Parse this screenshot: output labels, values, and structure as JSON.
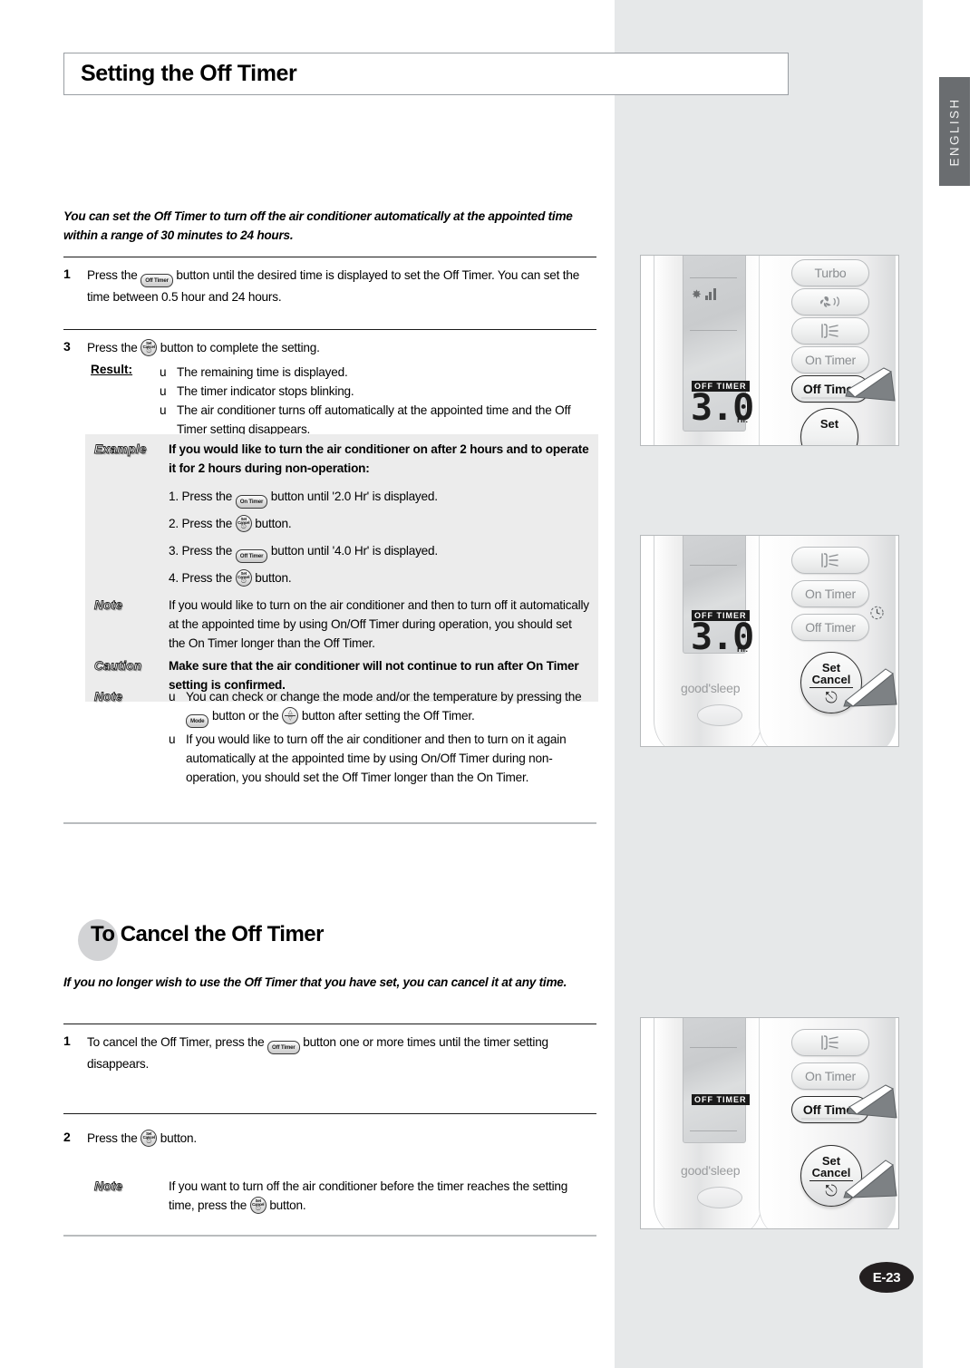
{
  "page": {
    "language_tab": "ENGLISH",
    "page_number": "E-23"
  },
  "title": "Setting the Off Timer",
  "section1": {
    "lead": "You can set the Off Timer to turn off the air conditioner automatically at the appointed time within a range of 30 minutes to 24 hours.",
    "step1": {
      "number": "1",
      "text_before": "Press the",
      "button": "Off Timer",
      "text_after": "button until the desired time is displayed to set the Off Timer. You can set the time between 0.5 hour and 24 hours."
    },
    "step3": {
      "number": "3",
      "text_before": "Press the",
      "button_line1": "Set",
      "button_line2": "Cancel",
      "text_after": "button to complete the setting."
    },
    "result": {
      "label": "Result:",
      "bullet_marker": "u",
      "items": [
        "The remaining time is displayed.",
        "The timer indicator stops blinking.",
        "The air conditioner turns off automatically at the appointed time and the Off Timer setting disappears."
      ]
    },
    "example": {
      "badge": "Example",
      "heading": "If you would like to turn the air conditioner on after 2 hours and to operate it for 2 hours during non-operation:",
      "steps": [
        {
          "num": "1.",
          "before": "Press the",
          "button": "On Timer",
          "after": "button until '2.0 Hr' is displayed."
        },
        {
          "num": "2.",
          "before": "Press the",
          "button_l1": "Set",
          "button_l2": "Cancel",
          "after": "button."
        },
        {
          "num": "3.",
          "before": "Press the",
          "button": "Off Timer",
          "after": "button until '4.0 Hr' is displayed."
        },
        {
          "num": "4.",
          "before": "Press the",
          "button_l1": "Set",
          "button_l2": "Cancel",
          "after": "button."
        }
      ]
    },
    "note_shaded": {
      "badge": "Note",
      "text": "If you would like to turn on the air conditioner and then to turn off it automatically at the appointed time by using On/Off Timer during operation, you should set the On Timer longer than the Off Timer."
    },
    "caution": {
      "badge": "Caution",
      "text": "Make sure that the air conditioner will not continue to run after On Timer setting is confirmed."
    },
    "note_bullets": {
      "badge": "Note",
      "bullet_marker": "u",
      "item1_before": "You can check or change the mode and/or the temperature by pressing the",
      "item1_button": "Mode",
      "item1_middle": "button or the",
      "item1_after": "button after setting the Off Timer.",
      "item2": "If you would like to turn off the air conditioner and then to turn on it again automatically at the appointed time by using On/Off Timer during non-operation, you should set the Off Timer longer than the On Timer."
    }
  },
  "section2": {
    "heading": "To Cancel the Off Timer",
    "lead": "If you no longer wish to use the Off Timer that you have set, you can cancel it at any time.",
    "step1": {
      "number": "1",
      "text_before": "To cancel the Off Timer, press the",
      "button": "Off Timer",
      "text_after": "button one or more times until the timer setting disappears."
    },
    "step2": {
      "number": "2",
      "text_before": "Press the",
      "button_line1": "Set",
      "button_line2": "Cancel",
      "text_after": "button."
    },
    "note": {
      "badge": "Note",
      "text_before": "If you want to turn off the air conditioner before the timer reaches the setting time, press the",
      "button_line1": "Set",
      "button_line2": "Cancel",
      "text_after": "button."
    }
  },
  "illustrations": [
    {
      "name": "remote-step1",
      "lcd": {
        "indicator": "OFF  TIMER",
        "value": "3.0",
        "unit": "Hr.",
        "fan_icon": "fan-speed-icon"
      },
      "buttons": [
        "Turbo",
        "fan-speed-icon",
        "air-swing-icon",
        "On Timer",
        "Off Timer",
        "Set"
      ],
      "highlighted": "Off Timer",
      "cursors": 1
    },
    {
      "name": "remote-step3",
      "lcd": {
        "indicator": "OFF  TIMER",
        "value": "3.0",
        "unit": "Hr."
      },
      "brand": "good'sleep",
      "buttons": [
        "air-swing-icon",
        "On Timer",
        "Off Timer"
      ],
      "set_button_line1": "Set",
      "set_button_line2": "Cancel",
      "highlighted": "Set Cancel",
      "cursors": 1
    },
    {
      "name": "remote-cancel",
      "lcd": {
        "indicator": "OFF  TIMER",
        "value": "",
        "unit": ""
      },
      "brand": "good'sleep",
      "buttons": [
        "air-swing-icon",
        "On Timer",
        "Off Timer"
      ],
      "set_button_line1": "Set",
      "set_button_line2": "Cancel",
      "highlighted": "Off Timer, Set Cancel",
      "cursors": 2
    }
  ],
  "colors": {
    "panel_gray": "#e6e8e9",
    "tab_gray": "#6a6d70",
    "shade_gray": "#ececec",
    "page_badge": "#231f20"
  }
}
